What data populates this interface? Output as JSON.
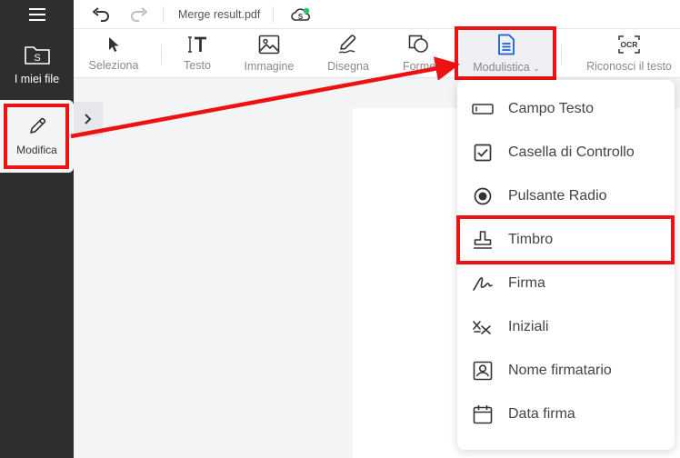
{
  "topbar": {
    "document_name": "Merge result.pdf"
  },
  "rail": {
    "files_label": "I miei file",
    "files_icon_letter": "S",
    "modifica_label": "Modifica"
  },
  "toolbar": {
    "tools": [
      {
        "label": "Seleziona",
        "icon": "cursor-icon"
      },
      {
        "label": "Testo",
        "icon": "text-icon"
      },
      {
        "label": "Immagine",
        "icon": "image-icon"
      },
      {
        "label": "Disegna",
        "icon": "pen-icon"
      },
      {
        "label": "Forme",
        "icon": "shapes-icon"
      },
      {
        "label": "Modulistica",
        "icon": "form-document-icon"
      },
      {
        "label": "Riconosci il testo",
        "icon": "ocr-icon"
      }
    ],
    "ocr_badge": "OCR"
  },
  "dropdown": {
    "items": [
      {
        "label": "Campo Testo",
        "icon": "text-field-icon"
      },
      {
        "label": "Casella di Controllo",
        "icon": "checkbox-icon"
      },
      {
        "label": "Pulsante Radio",
        "icon": "radio-button-icon"
      },
      {
        "label": "Timbro",
        "icon": "stamp-icon"
      },
      {
        "label": "Firma",
        "icon": "signature-icon"
      },
      {
        "label": "Iniziali",
        "icon": "initials-icon"
      },
      {
        "label": "Nome firmatario",
        "icon": "signer-name-icon"
      },
      {
        "label": "Data firma",
        "icon": "calendar-icon"
      }
    ]
  },
  "colors": {
    "highlight": "#ee1111",
    "accent": "#1a5fd6",
    "rail_bg": "#2e2e2e"
  }
}
